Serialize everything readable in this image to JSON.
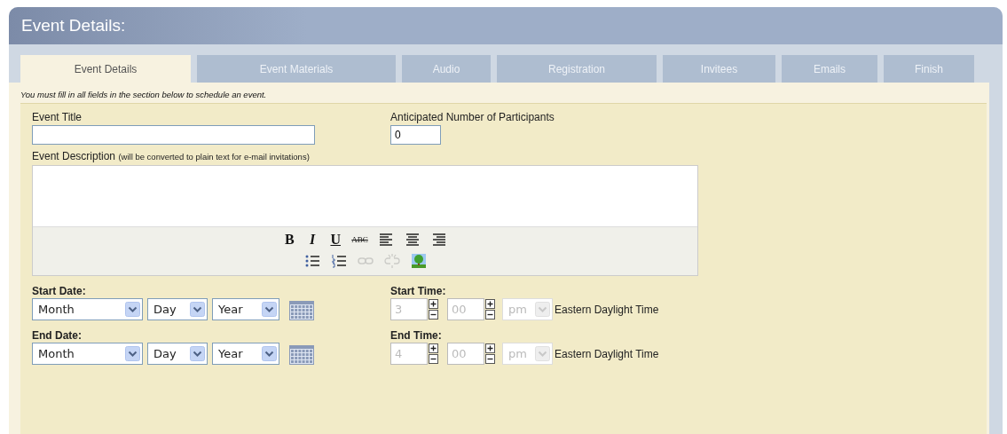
{
  "window": {
    "title": "Event Details:"
  },
  "tabs": [
    {
      "label": "Event Details",
      "selected": true
    },
    {
      "label": "Event Materials",
      "selected": false
    },
    {
      "label": "Audio",
      "selected": false
    },
    {
      "label": "Registration",
      "selected": false
    },
    {
      "label": "Invitees",
      "selected": false
    },
    {
      "label": "Emails",
      "selected": false
    },
    {
      "label": "Finish",
      "selected": false
    }
  ],
  "notice": "You must fill in all fields in the section below to schedule an event.",
  "event_title": {
    "label": "Event Title"
  },
  "participants": {
    "label": "Anticipated Number of Participants",
    "value": "0"
  },
  "description": {
    "label": "Event Description",
    "hint": "(will be converted to plain text for e-mail invitations)",
    "toolbar": [
      [
        {
          "kind": "bold",
          "label": "B",
          "disabled": false
        },
        {
          "kind": "italic",
          "label": "I",
          "disabled": false
        },
        {
          "kind": "underline",
          "label": "U",
          "disabled": false
        },
        {
          "kind": "strike",
          "label": "ABC",
          "disabled": false
        },
        {
          "kind": "align-left",
          "disabled": false
        },
        {
          "kind": "align-center",
          "disabled": false
        },
        {
          "kind": "align-right",
          "disabled": false
        }
      ],
      [
        {
          "kind": "bullets",
          "disabled": false
        },
        {
          "kind": "numbers",
          "disabled": false
        },
        {
          "kind": "link",
          "disabled": true
        },
        {
          "kind": "unlink",
          "disabled": true
        },
        {
          "kind": "image",
          "disabled": false
        }
      ]
    ]
  },
  "dates": [
    {
      "label": "Start Date:",
      "month": "Month",
      "day": "Day",
      "year": "Year"
    },
    {
      "label": "End Date:",
      "month": "Month",
      "day": "Day",
      "year": "Year"
    }
  ],
  "times": [
    {
      "label": "Start Time:",
      "hour": "3",
      "minute": "00",
      "ampm": "pm",
      "zone": "Eastern Daylight Time",
      "disabled": true
    },
    {
      "label": "End Time:",
      "hour": "4",
      "minute": "00",
      "ampm": "pm",
      "zone": "Eastern Daylight Time",
      "disabled": true
    }
  ]
}
